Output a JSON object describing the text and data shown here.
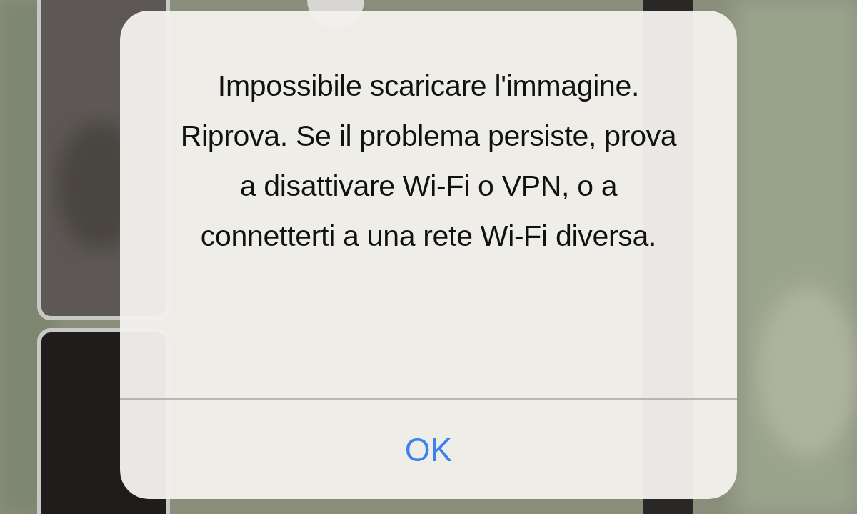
{
  "alert": {
    "message": "Impossibile scaricare l'immagine. Riprova. Se il problema persiste, prova a disattivare Wi-Fi o VPN, o a connetterti a una rete Wi-Fi diversa.",
    "buttons": [
      "OK"
    ]
  }
}
